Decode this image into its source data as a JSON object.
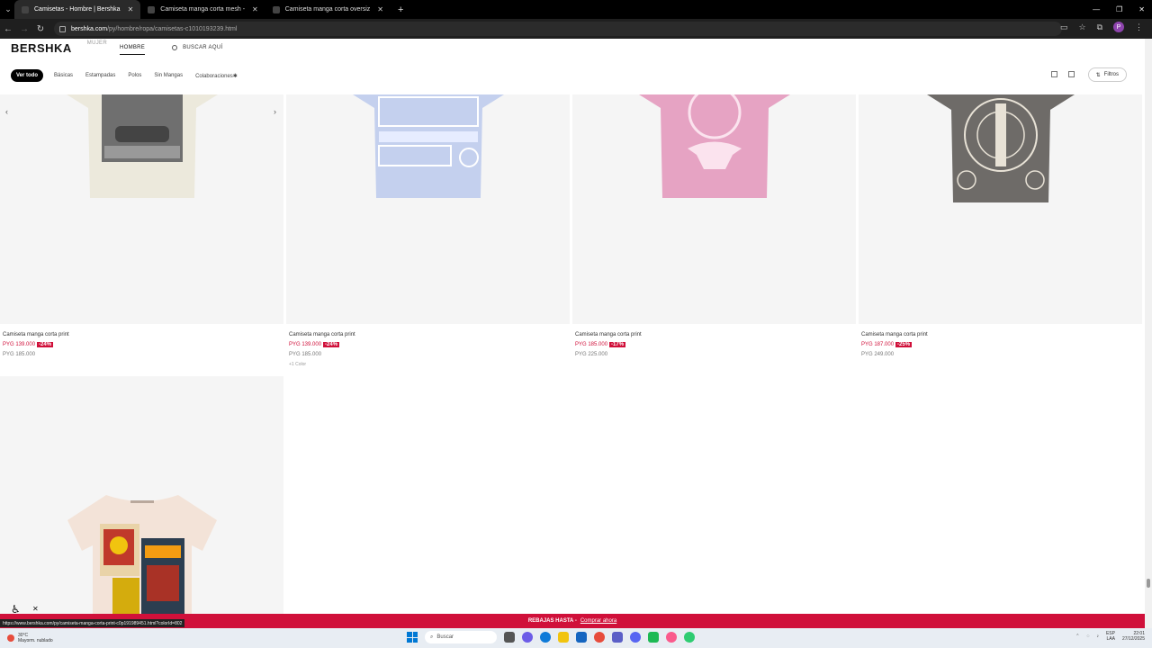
{
  "browser": {
    "tabs": [
      {
        "title": "Camisetas - Hombre | Bershka",
        "active": true
      },
      {
        "title": "Camiseta manga corta mesh -",
        "active": false
      },
      {
        "title": "Camiseta manga corta oversiz",
        "active": false
      }
    ],
    "url_host": "bershka.com",
    "url_path": "/py/hombre/ropa/camisetas-c1010193239.html"
  },
  "site": {
    "logo": "BERSHKA",
    "nav": [
      {
        "label": "MUJER",
        "active": false
      },
      {
        "label": "HOMBRE",
        "active": true
      }
    ],
    "search_label": "BUSCAR AQUÍ"
  },
  "filters": {
    "chips": [
      "Ver todo",
      "Básicas",
      "Estampadas",
      "Polos",
      "Sin Mangas",
      "Colaboraciones✱"
    ],
    "filtros_label": "Filtros"
  },
  "products": [
    {
      "name": "Camiseta manga corta print",
      "price_now": "PYG 139.000",
      "discount": "-24%",
      "price_old": "PYG 185.000",
      "colors": ""
    },
    {
      "name": "Camiseta manga corta print",
      "price_now": "PYG 139.000",
      "discount": "-24%",
      "price_old": "PYG 185.000",
      "colors": "+1 Color"
    },
    {
      "name": "Camiseta manga corta print",
      "price_now": "PYG 185.000",
      "discount": "-17%",
      "price_old": "PYG 225.000",
      "colors": ""
    },
    {
      "name": "Camiseta manga corta print",
      "price_now": "PYG 187.000",
      "discount": "-25%",
      "price_old": "PYG 249.000",
      "colors": ""
    }
  ],
  "promo": {
    "text": "REBAJAS HASTA -",
    "link": "Comprar ahora"
  },
  "status_url": "https://www.bershka.com/py/camiseta-manga-corta-print-c0p191989451.html?colorId=802",
  "taskbar": {
    "weather_temp": "30°C",
    "weather_desc": "Mayorm. nublado",
    "search": "Buscar",
    "lang_1": "ESP",
    "lang_2": "LAA",
    "time": "22:01",
    "date": "27/12/2025"
  },
  "colors": {
    "accent": "#d0103a",
    "tee1": "#ece9dc",
    "tee2": "#c4d0ee",
    "tee3": "#e6a3c3",
    "tee4": "#6e6b68",
    "tee5": "#f3e3d8"
  }
}
